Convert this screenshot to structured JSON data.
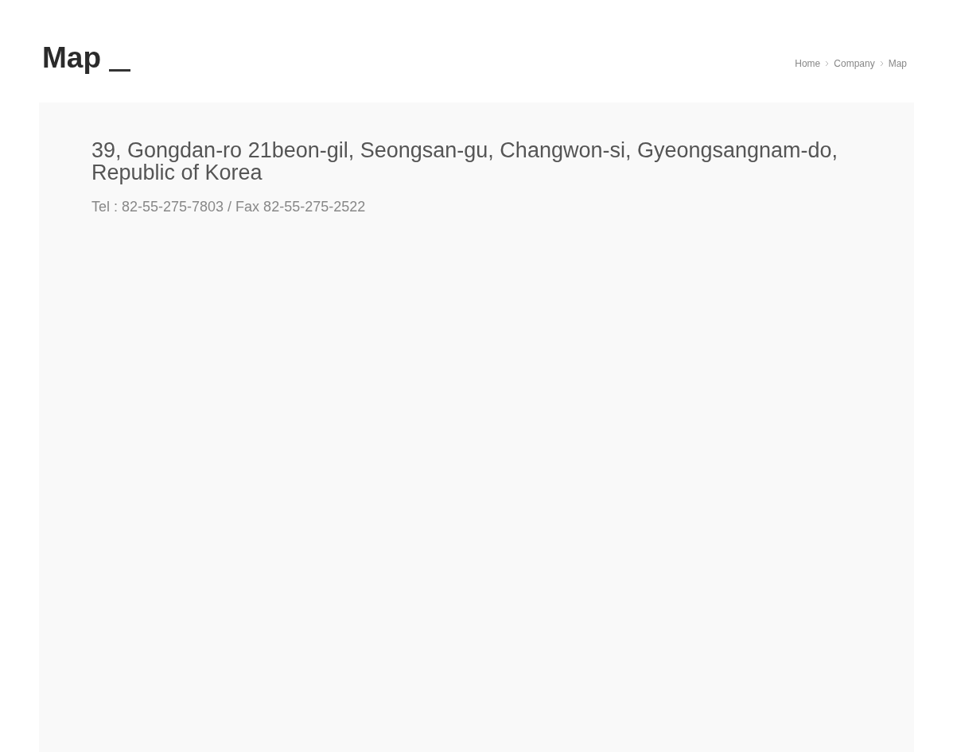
{
  "page_title": "Map",
  "breadcrumb": [
    {
      "label": "Home"
    },
    {
      "label": "Company"
    },
    {
      "label": "Map"
    }
  ],
  "address": "39, Gongdan-ro 21beon-gil, Seongsan-gu, Changwon-si, Gyeongsangnam-do, Republic of Korea",
  "contact": "Tel : 82-55-275-7803 / Fax 82-55-275-2522"
}
